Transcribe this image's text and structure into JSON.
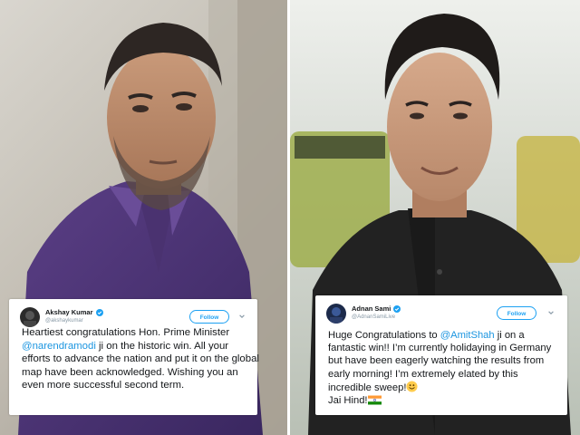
{
  "left_tweet": {
    "name": "Akshay Kumar",
    "handle": "@akshaykumar",
    "follow_label": "Follow",
    "text_1": "Heartiest congratulations Hon. Prime Minister",
    "mention": "@narendramodi",
    "text_2": " ji on the historic win. All your efforts to advance the nation and put it on the global map have been acknowledged. Wishing you an even more successful second term."
  },
  "right_tweet": {
    "name": "Adnan Sami",
    "handle": "@AdnanSamiLive",
    "follow_label": "Follow",
    "text_1": "Huge Congratulations to ",
    "mention": "@AmitShah",
    "text_2": " ji on a fantastic win!! I’m currently holidaying in Germany but have been eagerly watching the results from early morning! I’m extremely elated by this incredible sweep!",
    "text_3": "Jai Hind!"
  },
  "colors": {
    "twitter_blue": "#1da1f2",
    "mention_blue": "#1b95e0",
    "text_dark": "#14171a",
    "handle_gray": "#8899a6"
  },
  "icons": [
    "verified-badge-icon",
    "chevron-down-icon",
    "smiley-emoji-icon",
    "india-flag-icon"
  ]
}
